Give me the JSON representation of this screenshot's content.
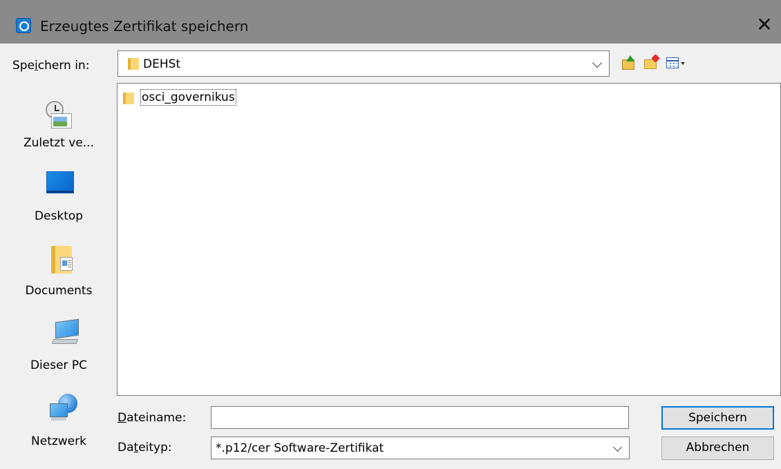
{
  "window": {
    "title": "Erzeugtes Zertifikat speichern",
    "close_glyph": "✕"
  },
  "toolbar": {
    "lookin_label_pre": "Spe",
    "lookin_label_u": "i",
    "lookin_label_post": "chern in:",
    "current_folder": "DEHSt",
    "icons": [
      "up-one-level-icon",
      "new-folder-icon",
      "view-menu-icon"
    ]
  },
  "places": [
    {
      "label": "Zuletzt ve...",
      "icon": "recent-items-icon"
    },
    {
      "label": "Desktop",
      "icon": "desktop-icon"
    },
    {
      "label": "Documents",
      "icon": "documents-folder-icon"
    },
    {
      "label": "Dieser PC",
      "icon": "computer-icon"
    },
    {
      "label": "Netzwerk",
      "icon": "network-icon"
    }
  ],
  "files": [
    {
      "name": "osci_governikus",
      "type": "folder"
    }
  ],
  "form": {
    "filename_label_u": "D",
    "filename_label_rest": "ateiname:",
    "filename_value": "",
    "filetype_label_pre": "Da",
    "filetype_label_u": "t",
    "filetype_label_post": "eityp:",
    "filetype_value": "*.p12/cer Software-Zertifikat"
  },
  "buttons": {
    "save": "Speichern",
    "cancel": "Abbrechen"
  }
}
